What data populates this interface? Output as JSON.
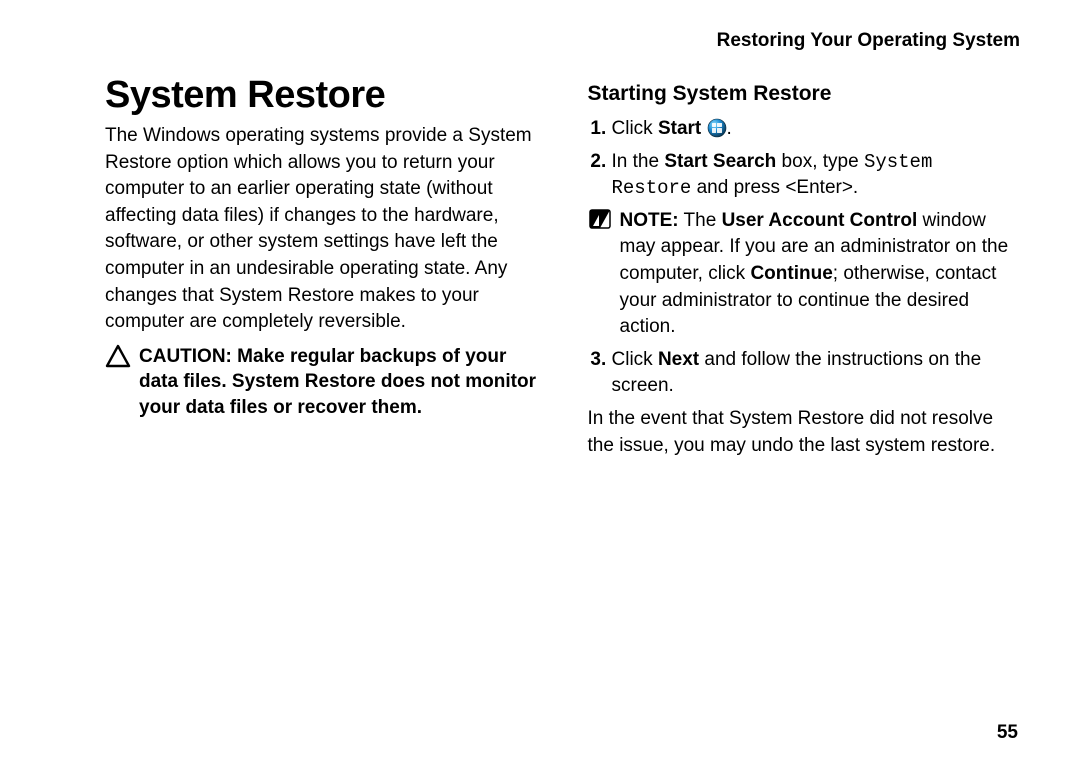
{
  "header": "Restoring Your Operating System",
  "left": {
    "title": "System Restore",
    "body": "The Windows operating systems provide a System Restore option which allows you to return your computer to an earlier operating state (without affecting data files) if changes to the hardware, software, or other system settings have left the computer in an undesirable operating state. Any changes that System Restore makes to your computer are completely reversible.",
    "caution_label": "CAUTION:",
    "caution_text": " Make regular backups of your data files. System Restore does not monitor your data files or recover them."
  },
  "right": {
    "subtitle": "Starting System Restore",
    "step1_pre": "Click ",
    "step1_bold": "Start",
    "step1_post": " ",
    "step1_tail": ".",
    "step2_pre": "In the ",
    "step2_bold": "Start Search",
    "step2_mid": " box, type ",
    "step2_mono": "System Restore",
    "step2_post": " and press <Enter>.",
    "note_label": "NOTE:",
    "note_pre": " The ",
    "note_b1": "User Account Control",
    "note_mid1": " window may appear. If you are an administrator on the computer, click ",
    "note_b2": "Continue",
    "note_mid2": "; otherwise, contact your administrator to continue the desired action.",
    "step3_pre": "Click ",
    "step3_bold": "Next",
    "step3_post": " and follow the instructions on the screen.",
    "closing": "In the event that System Restore did not resolve the issue, you may undo the last system restore."
  },
  "page_number": "55"
}
